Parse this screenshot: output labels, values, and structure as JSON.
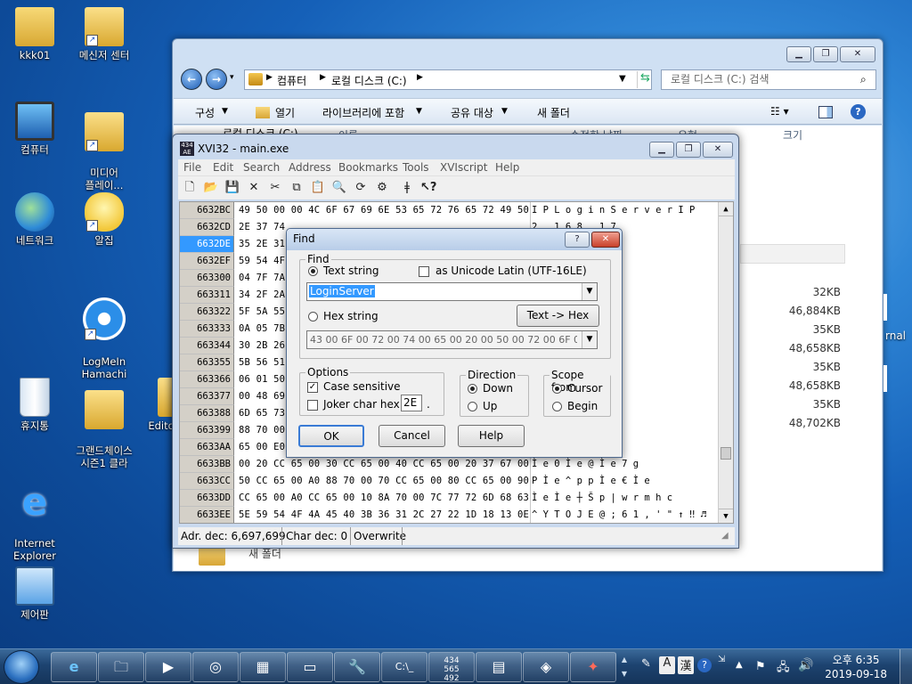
{
  "desktop": {
    "icons": [
      {
        "label": "kkk01"
      },
      {
        "label": "메신저 센터"
      },
      {
        "label": "컴퓨터"
      },
      {
        "label": "미디어\n플레이..."
      },
      {
        "label": "네트워크"
      },
      {
        "label": "알집"
      },
      {
        "label": "LogMeIn\nHamachi"
      },
      {
        "label": "휴지통"
      },
      {
        "label": "그랜드체이스\n시즌1 클라"
      },
      {
        "label": "Edito"
      },
      {
        "label": "Internet\nExplorer"
      },
      {
        "label": "제어판"
      }
    ],
    "edge_text": "rnal"
  },
  "explorer": {
    "address": [
      "컴퓨터",
      "로컬 디스크 (C:)"
    ],
    "search_placeholder": "로컬 디스크 (C:) 검색",
    "commands": [
      "구성",
      "열기",
      "라이브러리에 포함",
      "공유 대상",
      "새 폴더"
    ],
    "nav_item": "로컬 디스크 (C:)",
    "columns": [
      "이름",
      "수정한 날짜",
      "유형",
      "크기"
    ],
    "sizes": [
      "32KB",
      "46,884KB",
      "35KB",
      "48,658KB",
      "35KB",
      "48,658KB",
      "35KB",
      "48,702KB"
    ],
    "bottom_item": "새 폴더"
  },
  "xvi32": {
    "title": "XVI32 - main.exe",
    "menu": [
      "File",
      "Edit",
      "Search",
      "Address",
      "Bookmarks",
      "Tools",
      "XVIscript",
      "Help"
    ],
    "rows": [
      {
        "addr": "6632BC",
        "hex": "49 50 00 00 4C 6F 67 69 6E 53 65 72 76 65 72 49 50",
        "ascii": "I P     L o g i n S e r v e r I P"
      },
      {
        "addr": "6632CD",
        "hex": "2E 37 74",
        "ascii": "2 . 1 6 8 . 1 7"
      },
      {
        "addr": "6632DE",
        "hex": "35 2E 31",
        "ascii": "  | w r m h c ^"
      },
      {
        "addr": "6632EF",
        "hex": "59 54 4F",
        "ascii": ", ' \"   ↑ ‼ ♬"
      },
      {
        "addr": "663300",
        "hex": "04 7F 7A",
        "ascii": "\\ W R M H C > 9"
      },
      {
        "addr": "663311",
        "hex": "34 2F 2A",
        "ascii": "● ↑ } x s n i d"
      },
      {
        "addr": "663322",
        "hex": "5F 5A 55",
        "ascii": "2 - ( #   ├ ¶ ☼"
      },
      {
        "addr": "663333",
        "hex": "0A 05 7B",
        "ascii": "X S N I D ? : 5"
      },
      {
        "addr": "663344",
        "hex": "30 2B 26",
        "ascii": "└ ~ y t o j e `"
      },
      {
        "addr": "663355",
        "hex": "5B 56 51",
        "ascii": ". ) $   → ─ ┼ ♂"
      },
      {
        "addr": "663366",
        "hex": "06 01 50",
        "ascii": "  T i £   P i £"
      },
      {
        "addr": "663377",
        "hex": "00 48 69",
        "ascii": "  i £   ÷ i £"
      },
      {
        "addr": "663388",
        "hex": "6D 65 73",
        "ascii": "k _ b t"
      },
      {
        "addr": "663399",
        "hex": "88 70 00",
        "ascii": "p   À ‡ p   ┼ È"
      },
      {
        "addr": "6633AA",
        "hex": "65 00 E0",
        "ascii": "    Ì e   ┼ Ì e"
      },
      {
        "addr": "6633BB",
        "hex": "00 20 CC 65 00 30 CC 65 00 40 CC 65 00 20 37 67 00",
        "ascii": "  Ì e   0 Ì e   @ Ì e   7 g"
      },
      {
        "addr": "6633CC",
        "hex": "50 CC 65 00 A0 88 70 00 70 CC 65 00 80 CC 65 00 90",
        "ascii": "P Ì e   ^ p   p Ì e   € Ì e"
      },
      {
        "addr": "6633DD",
        "hex": "CC 65 00 A0 CC 65 00 10 8A 70 00 7C 77 72 6D 68 63",
        "ascii": "Ì e   Ì e   ┼ Š p   | w r m h c"
      },
      {
        "addr": "6633EE",
        "hex": "5E 59 54 4F 4A 45 40 3B 36 31 2C 27 22 1D 18 13 0E",
        "ascii": "^ Y T O J E @ ; 6 1 , ' \"   ↑ ‼ ♬"
      }
    ],
    "status": {
      "addr_dec": "Adr. dec: 6,697,699",
      "char_dec": "Char dec: 0",
      "mode": "Overwrite"
    }
  },
  "find": {
    "title": "Find",
    "group_find": "Find",
    "text_string_label": "Text string",
    "unicode_label": "as Unicode Latin (UTF-16LE)",
    "search_value": "LoginServer",
    "hex_string_label": "Hex string",
    "text_to_hex": "Text -> Hex",
    "hex_value": "43 00 6F 00 72 00 74 00 65 00 20 00 50 00 72 00 6F 00 66 00 7",
    "options_label": "Options",
    "case_sensitive": "Case sensitive",
    "joker_label": "Joker char hex:",
    "joker_value": "2E",
    "direction_label": "Direction",
    "down": "Down",
    "up": "Up",
    "scope_label": "Scope from",
    "cursor": "Cursor",
    "begin": "Begin",
    "ok": "OK",
    "cancel": "Cancel",
    "help": "Help"
  },
  "taskbar": {
    "tray": [
      "A",
      "漢"
    ],
    "time": "오후 6:35",
    "date": "2019-09-18"
  }
}
